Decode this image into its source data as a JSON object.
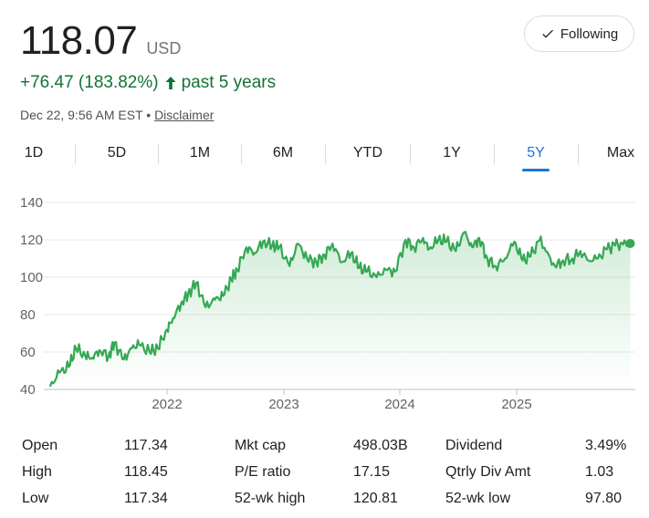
{
  "quote": {
    "price": "118.07",
    "currency": "USD",
    "change": "+76.47 (183.82%)",
    "period": "past 5 years",
    "timestamp": "Dec 22, 9:56 AM EST",
    "separator": "•",
    "disclaimer": "Disclaimer",
    "follow_label": "Following",
    "accent_color": "#137333"
  },
  "tabs": [
    {
      "label": "1D",
      "active": false
    },
    {
      "label": "5D",
      "active": false
    },
    {
      "label": "1M",
      "active": false
    },
    {
      "label": "6M",
      "active": false
    },
    {
      "label": "YTD",
      "active": false
    },
    {
      "label": "1Y",
      "active": false
    },
    {
      "label": "5Y",
      "active": true
    },
    {
      "label": "Max",
      "active": false
    }
  ],
  "chart_data": {
    "type": "area",
    "ylim": [
      40,
      140
    ],
    "yticks": [
      40,
      60,
      80,
      100,
      120,
      140
    ],
    "xlim": [
      2021.0,
      2026.0
    ],
    "xticks": [
      {
        "label": "2022",
        "x": 2022.0
      },
      {
        "label": "2023",
        "x": 2023.0
      },
      {
        "label": "2024",
        "x": 2024.0
      },
      {
        "label": "2025",
        "x": 2025.0
      }
    ],
    "line_color": "#34a853",
    "series": [
      {
        "x": [
          2021.0,
          2021.08,
          2021.16,
          2021.22,
          2021.3,
          2021.36,
          2021.42,
          2021.5,
          2021.55,
          2021.63,
          2021.7,
          2021.76,
          2021.85,
          2021.92,
          2022.0,
          2022.05,
          2022.12,
          2022.18,
          2022.25,
          2022.33,
          2022.41,
          2022.48,
          2022.55,
          2022.6,
          2022.68,
          2022.75,
          2022.82,
          2022.9,
          2022.96,
          2023.05,
          2023.12,
          2023.2,
          2023.28,
          2023.35,
          2023.42,
          2023.5,
          2023.58,
          2023.65,
          2023.72,
          2023.8,
          2023.88,
          2023.96,
          2024.05,
          2024.12,
          2024.2,
          2024.25,
          2024.33,
          2024.4,
          2024.48,
          2024.55,
          2024.62,
          2024.68,
          2024.75,
          2024.82,
          2024.9,
          2024.98,
          2025.05,
          2025.12,
          2025.2,
          2025.25,
          2025.33,
          2025.4,
          2025.48,
          2025.55,
          2025.62,
          2025.7,
          2025.78,
          2025.85,
          2025.92,
          2025.98
        ],
        "y": [
          41.5,
          49,
          52,
          62,
          58,
          57,
          61,
          58,
          65,
          56,
          62,
          64,
          60,
          62,
          72,
          78,
          86,
          91,
          97,
          84,
          88,
          90,
          99,
          104,
          116,
          113,
          119,
          117,
          116,
          106,
          118,
          110,
          108,
          112,
          118,
          108,
          113,
          105,
          103,
          100,
          104,
          103,
          120,
          116,
          121,
          115,
          120,
          119,
          114,
          124,
          116,
          121,
          110,
          106,
          110,
          119,
          109,
          111,
          120,
          114,
          106,
          109,
          110,
          114,
          109,
          110,
          115,
          117,
          117.5,
          118.07
        ]
      }
    ]
  },
  "stats": [
    {
      "label": "Open",
      "value": "117.34"
    },
    {
      "label": "High",
      "value": "118.45"
    },
    {
      "label": "Low",
      "value": "117.34"
    },
    {
      "label": "Mkt cap",
      "value": "498.03B"
    },
    {
      "label": "P/E ratio",
      "value": "17.15"
    },
    {
      "label": "52-wk high",
      "value": "120.81"
    },
    {
      "label": "Dividend",
      "value": "3.49%"
    },
    {
      "label": "Qtrly Div Amt",
      "value": "1.03"
    },
    {
      "label": "52-wk low",
      "value": "97.80"
    }
  ]
}
